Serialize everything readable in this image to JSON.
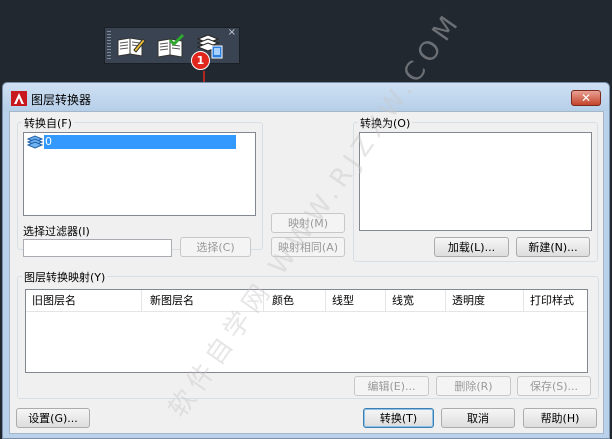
{
  "toolbar": {
    "close_glyph": "×",
    "buttons": [
      {
        "icon": "layer-properties-edit-icon"
      },
      {
        "icon": "layer-check-icon"
      },
      {
        "icon": "layer-translator-icon"
      }
    ]
  },
  "annotation": {
    "badge": "1"
  },
  "dialog": {
    "title": "图层转换器",
    "close_glyph": "✕",
    "translate_from": {
      "label": "转换自(F)",
      "items": [
        {
          "name": "0",
          "selected": true
        }
      ]
    },
    "selection_filter": {
      "label": "选择过滤器(I)",
      "value": "",
      "select_button": "选择(C)"
    },
    "map_button": "映射(M)",
    "map_same_button": "映射相同(A)",
    "translate_to": {
      "label": "转换为(O)",
      "items": [],
      "load_button": "加载(L)...",
      "new_button": "新建(N)..."
    },
    "layer_mappings": {
      "label": "图层转换映射(Y)",
      "columns": [
        "旧图层名",
        "新图层名",
        "颜色",
        "线型",
        "线宽",
        "透明度",
        "打印样式"
      ],
      "rows": [],
      "edit_button": "编辑(E)...",
      "delete_button": "删除(R)",
      "save_button": "保存(S)..."
    },
    "settings_button": "设置(G)...",
    "translate_button": "转换(T)",
    "cancel_button": "取消",
    "help_button": "帮助(H)"
  },
  "watermark": "软件自学网 WWW.RJZXW.COM",
  "colors": {
    "desktop": "#212830",
    "dialog_frame": "#b9d1ea",
    "selection": "#3399ff",
    "badge": "#e1271d",
    "app_icon": "#c8191f"
  }
}
